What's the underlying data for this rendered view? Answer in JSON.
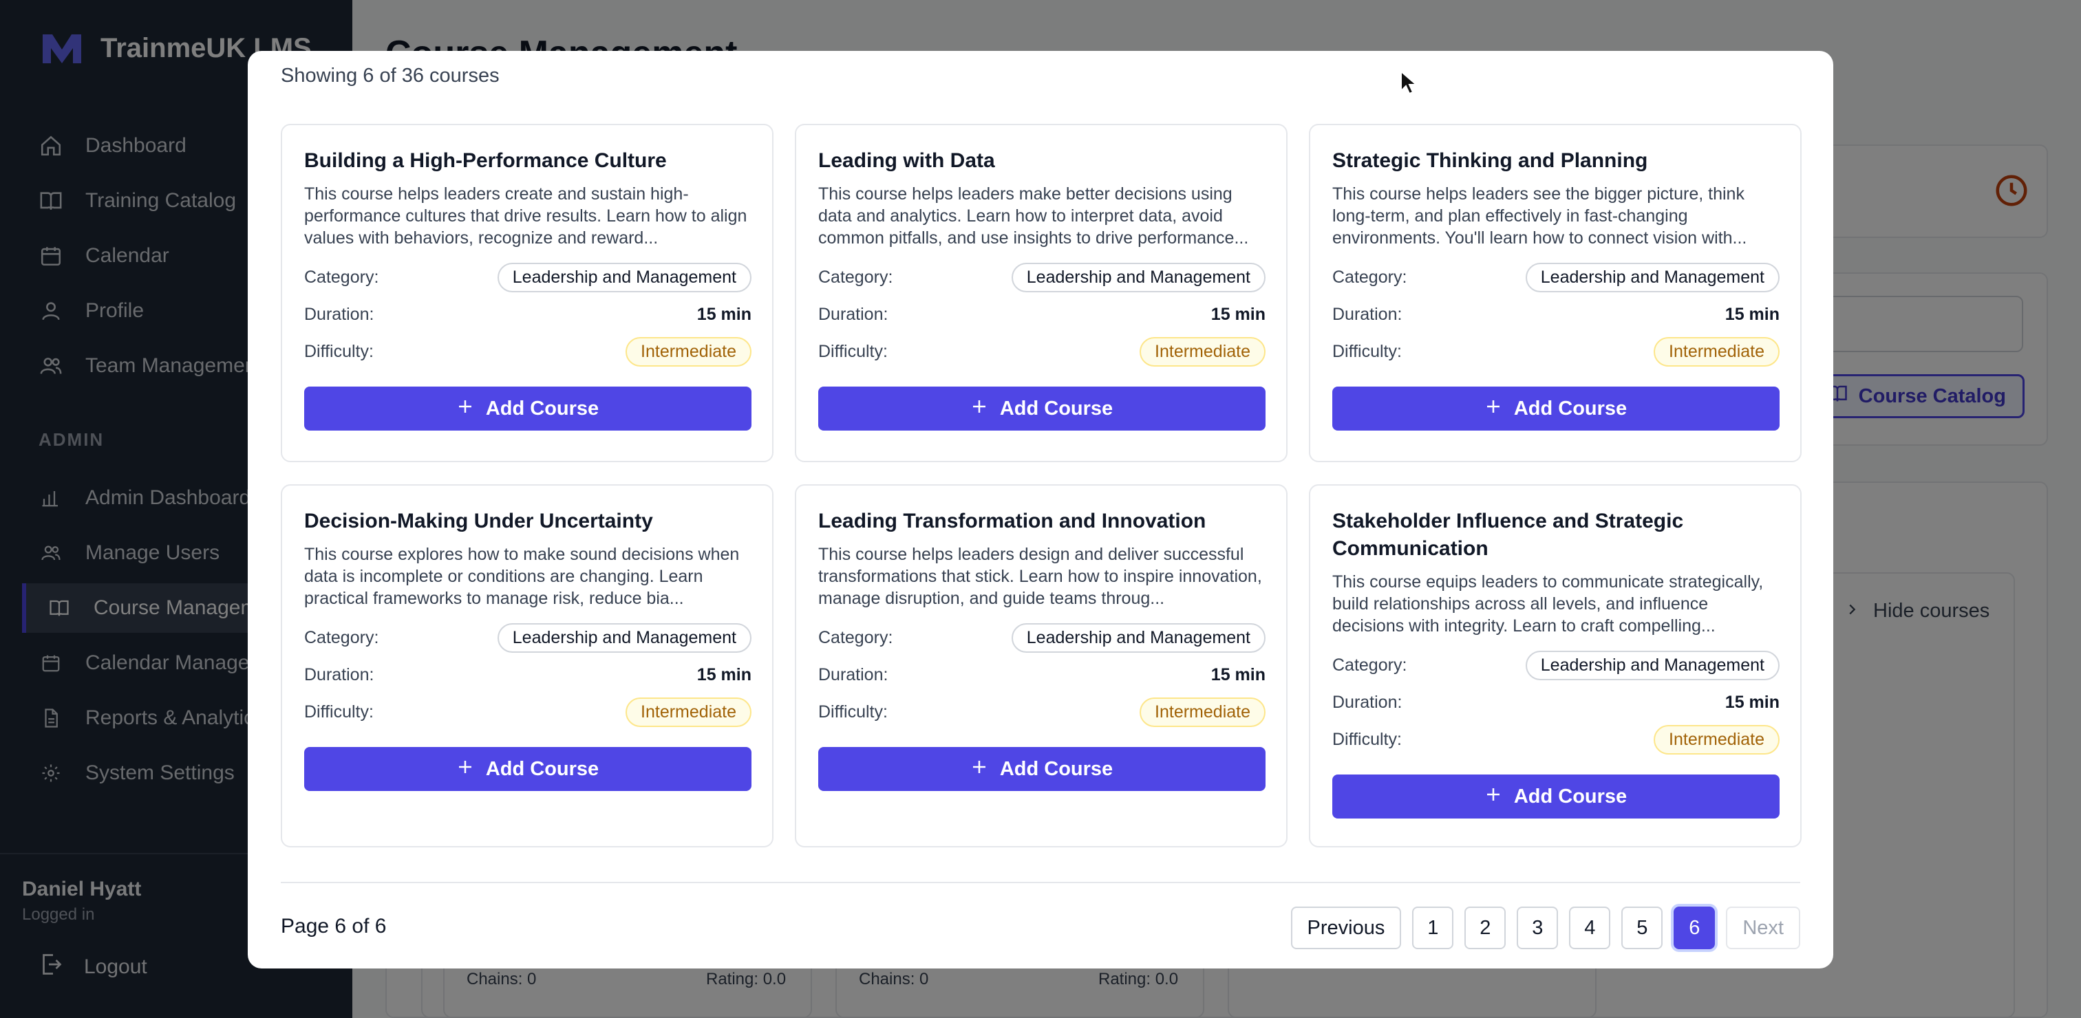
{
  "sidebar": {
    "brand": "TrainmeUK LMS",
    "nav": [
      {
        "label": "Dashboard",
        "icon": "home-icon"
      },
      {
        "label": "Training Catalog",
        "icon": "book-icon"
      },
      {
        "label": "Calendar",
        "icon": "calendar-icon"
      },
      {
        "label": "Profile",
        "icon": "user-icon"
      },
      {
        "label": "Team Management",
        "icon": "users-icon"
      }
    ],
    "admin_label": "ADMIN",
    "admin_nav": [
      {
        "label": "Admin Dashboard",
        "icon": "bar-chart-icon"
      },
      {
        "label": "Manage Users",
        "icon": "users-icon"
      },
      {
        "label": "Course Management",
        "icon": "book-icon",
        "active": true
      },
      {
        "label": "Calendar Management",
        "icon": "calendar-icon"
      },
      {
        "label": "Reports & Analytics",
        "icon": "file-icon"
      },
      {
        "label": "System Settings",
        "icon": "gear-icon"
      }
    ],
    "user": {
      "name": "Daniel Hyatt",
      "status": "Logged in"
    },
    "logout": "Logout"
  },
  "background": {
    "title": "Course Management",
    "catalog_button": "Course Catalog",
    "hide_courses": "Hide courses",
    "cards": [
      {
        "chains": "Chains: 0",
        "rating": "Rating: 0.0"
      },
      {
        "chains": "Chains: 0",
        "rating": "Rating: 0.0"
      }
    ]
  },
  "modal": {
    "count_text": "Showing 6 of 36 courses",
    "labels": {
      "category": "Category:",
      "duration": "Duration:",
      "difficulty": "Difficulty:",
      "add": "Add Course"
    },
    "courses": [
      {
        "title": "Building a High-Performance Culture",
        "description": "This course helps leaders create and sustain high-performance cultures that drive results. Learn how to align values with behaviors, recognize and reward...",
        "category": "Leadership and Management",
        "duration": "15 min",
        "difficulty": "Intermediate"
      },
      {
        "title": "Leading with Data",
        "description": "This course helps leaders make better decisions using data and analytics. Learn how to interpret data, avoid common pitfalls, and use insights to drive performance...",
        "category": "Leadership and Management",
        "duration": "15 min",
        "difficulty": "Intermediate"
      },
      {
        "title": "Strategic Thinking and Planning",
        "description": "This course helps leaders see the bigger picture, think long-term, and plan effectively in fast-changing environments. You'll learn how to connect vision with...",
        "category": "Leadership and Management",
        "duration": "15 min",
        "difficulty": "Intermediate"
      },
      {
        "title": "Decision-Making Under Uncertainty",
        "description": "This course explores how to make sound decisions when data is incomplete or conditions are changing. Learn practical frameworks to manage risk, reduce bia...",
        "category": "Leadership and Management",
        "duration": "15 min",
        "difficulty": "Intermediate"
      },
      {
        "title": "Leading Transformation and Innovation",
        "description": "This course helps leaders design and deliver successful transformations that stick. Learn how to inspire innovation, manage disruption, and guide teams throug...",
        "category": "Leadership and Management",
        "duration": "15 min",
        "difficulty": "Intermediate"
      },
      {
        "title": "Stakeholder Influence and Strategic Communication",
        "description": "This course equips leaders to communicate strategically, build relationships across all levels, and influence decisions with integrity. Learn to craft compelling...",
        "category": "Leadership and Management",
        "duration": "15 min",
        "difficulty": "Intermediate"
      }
    ],
    "pagination": {
      "page_text": "Page 6 of 6",
      "previous": "Previous",
      "next": "Next",
      "pages": [
        "1",
        "2",
        "3",
        "4",
        "5",
        "6"
      ],
      "current": "6"
    }
  },
  "colors": {
    "primary": "#4f46e5",
    "sidebar": "#1f2937",
    "difficulty_bg": "#fefce8",
    "difficulty_text": "#a16207"
  }
}
